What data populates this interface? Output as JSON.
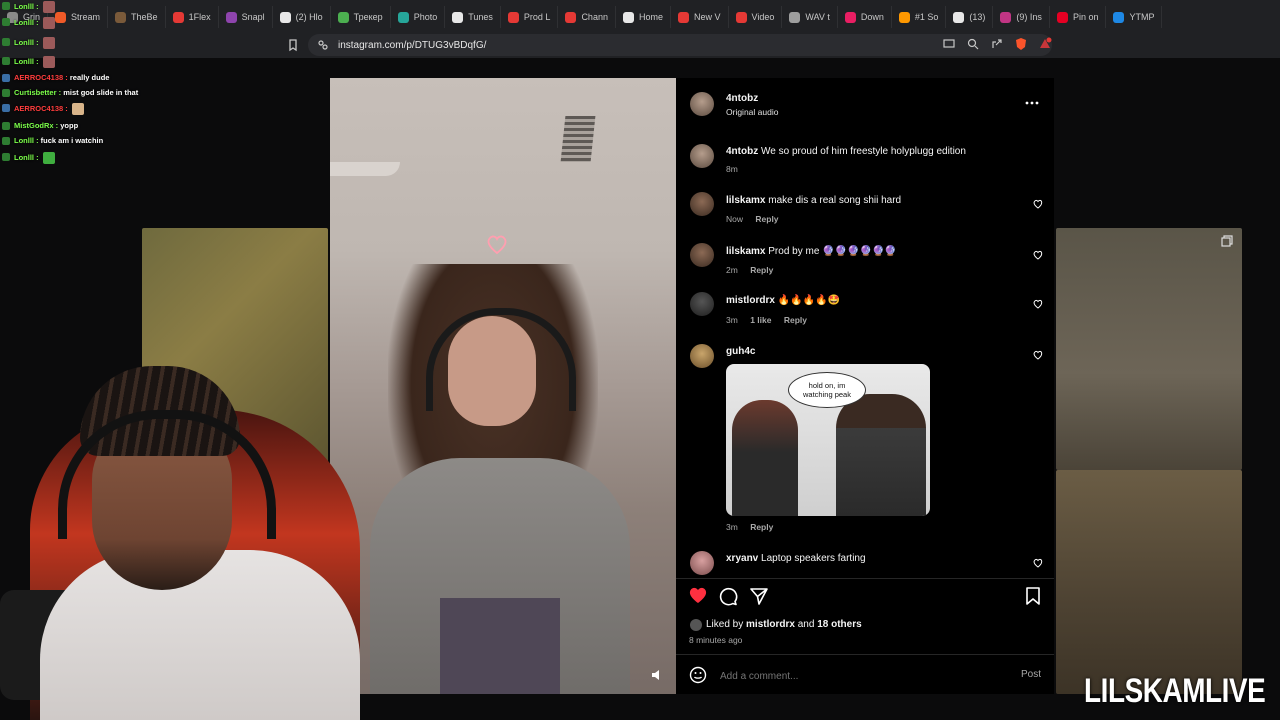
{
  "tabs": [
    {
      "label": "Grin",
      "color": "#8a8a8a"
    },
    {
      "label": "Stream",
      "color": "#f05a28"
    },
    {
      "label": "TheBe",
      "color": "#7a5a3a"
    },
    {
      "label": "1Flex",
      "color": "#e53935"
    },
    {
      "label": "Snapl",
      "color": "#8e44ad"
    },
    {
      "label": "(2) Hlo",
      "color": "#e8e8e8"
    },
    {
      "label": "Трекер",
      "color": "#4caf50"
    },
    {
      "label": "Photo",
      "color": "#26a69a"
    },
    {
      "label": "Tunes",
      "color": "#e8e8e8"
    },
    {
      "label": "Prod L",
      "color": "#e53935"
    },
    {
      "label": "Chann",
      "color": "#e53935"
    },
    {
      "label": "Home",
      "color": "#e8e8e8"
    },
    {
      "label": "New V",
      "color": "#e53935"
    },
    {
      "label": "Video",
      "color": "#e53935"
    },
    {
      "label": "WAV t",
      "color": "#9e9e9e"
    },
    {
      "label": "Down",
      "color": "#e91e63"
    },
    {
      "label": "#1 So",
      "color": "#ff9800"
    },
    {
      "label": "(13)",
      "color": "#e8e8e8"
    },
    {
      "label": "(9) Ins",
      "color": "#c13584"
    },
    {
      "label": "Pin on",
      "color": "#e60023"
    },
    {
      "label": "YTMP",
      "color": "#1e88e5"
    }
  ],
  "address": {
    "url": "instagram.com/p/DTUG3vBDqfG/"
  },
  "chat": [
    {
      "user": "Lonlll :",
      "user_color": "#7cff4a",
      "msg": "",
      "emote": "#9c5a5a"
    },
    {
      "user": "Lonlll :",
      "user_color": "#7cff4a",
      "msg": "",
      "emote": "#9c5a5a"
    },
    {
      "user": "Lonlll :",
      "user_color": "#7cff4a",
      "msg": "",
      "emote": "#9c5a5a"
    },
    {
      "user": "Lonlll :",
      "user_color": "#7cff4a",
      "msg": "",
      "emote": "#9c5a5a"
    },
    {
      "user": "AERROC4138 :",
      "user_color": "#ff3d3d",
      "msg": "really dude",
      "emote": ""
    },
    {
      "user": "Curtisbetter :",
      "user_color": "#7cff4a",
      "msg": "mist god slide in that",
      "emote": ""
    },
    {
      "user": "AERROC4138 :",
      "user_color": "#ff3d3d",
      "msg": "",
      "emote": "#d8b48a"
    },
    {
      "user": "MistGodRx :",
      "user_color": "#7cff4a",
      "msg": "yopp",
      "emote": ""
    },
    {
      "user": "Lonlll :",
      "user_color": "#7cff4a",
      "msg": "fuck am i watchin",
      "emote": ""
    },
    {
      "user": "Lonlll :",
      "user_color": "#7cff4a",
      "msg": "",
      "emote": "#3fae3f"
    }
  ],
  "post": {
    "author": "4ntobz",
    "audio": "Original audio",
    "caption_user": "4ntobz",
    "caption_text": "We so proud of him freestyle holyplugg edition",
    "caption_time": "8m",
    "comments": [
      {
        "user": "lilskamx",
        "text": "make dis a real song shii hard",
        "time": "Now",
        "likes": "",
        "reply": "Reply"
      },
      {
        "user": "lilskamx",
        "text": "Prod by me 🔮🔮🔮🔮🔮🔮",
        "time": "2m",
        "likes": "",
        "reply": "Reply"
      },
      {
        "user": "mistlordrx",
        "text": "🔥🔥🔥🔥🤩",
        "time": "3m",
        "likes": "1 like",
        "reply": "Reply"
      },
      {
        "user": "guh4c",
        "text": "",
        "time": "3m",
        "likes": "",
        "reply": "Reply"
      },
      {
        "user": "xryanv",
        "text": "Laptop speakers farting",
        "time": "",
        "likes": "",
        "reply": ""
      }
    ],
    "meme_bubble": "hold on, im watching peak",
    "liked_by_prefix": "Liked by",
    "liked_by_user": "mistlordrx",
    "liked_by_and": "and",
    "liked_by_others": "18 others",
    "post_time": "8 minutes ago",
    "comment_placeholder": "Add a comment...",
    "post_button": "Post"
  },
  "watermark": "LILSKAMLIVE",
  "colors": {
    "like_red": "#ff3040",
    "panel_bg": "#000000",
    "muted_text": "#a8a8a8"
  }
}
